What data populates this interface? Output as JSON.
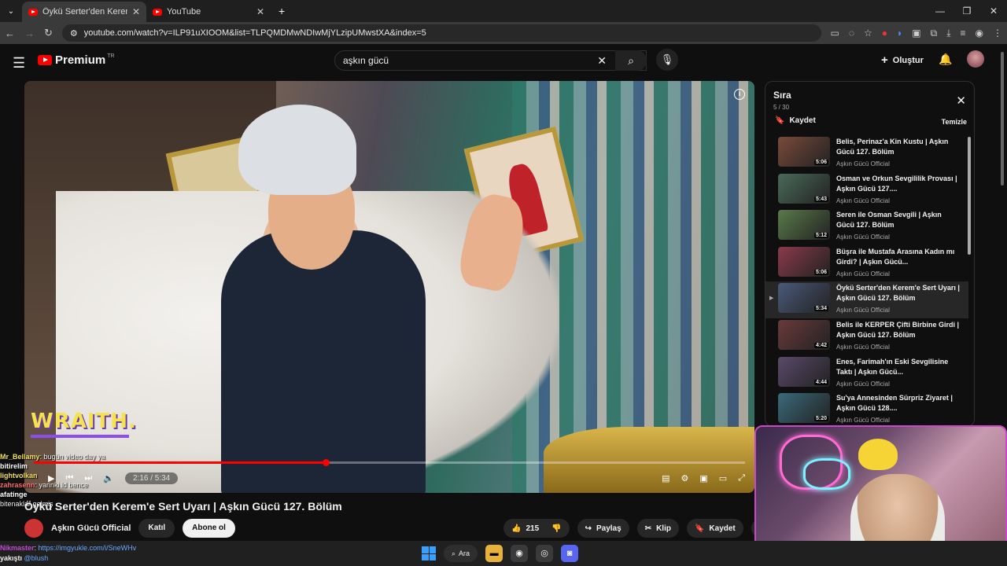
{
  "browser": {
    "tabs": [
      {
        "title": "Öykü Serter'den Kerem'e Sert Uyarı | Aşkın Gücü 127. Bölüm",
        "active": true
      },
      {
        "title": "YouTube",
        "active": false
      }
    ],
    "url": "youtube.com/watch?v=ILP91uXIOOM&list=TLPQMDMwNDIwMjYLzipUMwstXA&index=5"
  },
  "header": {
    "logo_text": "Premium",
    "logo_region": "TR",
    "search_value": "aşkın gücü",
    "create_label": "Oluştur"
  },
  "player": {
    "time": "2:16 / 5:34",
    "progress_fraction": 0.41,
    "overlay_logo": "WRAITH."
  },
  "video": {
    "title": "Öykü Serter'den Kerem'e Sert Uyarı | Aşkın Gücü 127. Bölüm",
    "channel": "Aşkın Gücü Official",
    "join_label": "Katıl",
    "subscribe_label": "Abone ol",
    "likes": "215",
    "share_label": "Paylaş",
    "clip_label": "Klip",
    "save_label": "Kaydet"
  },
  "playlist": {
    "title": "Sıra",
    "position": "5 / 30",
    "save_label": "Kaydet",
    "clear_label": "Temizle",
    "items": [
      {
        "title": "Belis, Perinaz'a Kin Kustu | Aşkın Gücü 127. Bölüm",
        "channel": "Aşkın Gücü Official",
        "duration": "5:06",
        "color": "#7a4a3a"
      },
      {
        "title": "Osman ve Orkun Sevgililik Provası | Aşkın Gücü 127....",
        "channel": "Aşkın Gücü Official",
        "duration": "5:43",
        "color": "#4a6a5a"
      },
      {
        "title": "Seren ile Osman Sevgili | Aşkın Gücü 127. Bölüm",
        "channel": "Aşkın Gücü Official",
        "duration": "5:12",
        "color": "#5a7a4a"
      },
      {
        "title": "Büşra ile Mustafa Arasına Kadın mı Girdi? | Aşkın Gücü...",
        "channel": "Aşkın Gücü Official",
        "duration": "5:06",
        "color": "#8a3a4a"
      },
      {
        "title": "Öykü Serter'den Kerem'e Sert Uyarı | Aşkın Gücü 127. Bölüm",
        "channel": "Aşkın Gücü Official",
        "duration": "5:34",
        "color": "#4a5a7a",
        "current": true
      },
      {
        "title": "Belis ile KERPER Çifti Birbine Girdi | Aşkın Gücü 127. Bölüm",
        "channel": "Aşkın Gücü Official",
        "duration": "4:42",
        "color": "#6a3a3a"
      },
      {
        "title": "Enes, Farimah'ın Eski Sevgilisine Taktı | Aşkın Gücü...",
        "channel": "Aşkın Gücü Official",
        "duration": "4:44",
        "color": "#5a4a6a"
      },
      {
        "title": "Su'ya Annesinden Sürpriz Ziyaret | Aşkın Gücü 128....",
        "channel": "Aşkın Gücü Official",
        "duration": "5:20",
        "color": "#3a6a7a"
      }
    ]
  },
  "stream_chat": [
    {
      "user": "Mr_Bellamy",
      "msg": ": bugün video day ya",
      "cls": "u2"
    },
    {
      "user": "bitirelim",
      "msg": "",
      "cls": "u4"
    },
    {
      "user": "lightvolkan",
      "msg": "",
      "cls": "u2"
    },
    {
      "user": "zahrasenn",
      "msg": ": yarinki ld bence",
      "cls": "u3"
    },
    {
      "user": "afatinge",
      "msg": "",
      "cls": "u4"
    },
    {
      "user": "",
      "msg": "bitenaklar gelmiş",
      "cls": "u4"
    }
  ],
  "chat_bottom": {
    "user": "Nikmaster",
    "link": "https://imgyukle.com/i/SneWHv",
    "line2_user": "yakıştı",
    "line2_msg": "@blush"
  },
  "taskbar": {
    "search_label": "Ara"
  }
}
